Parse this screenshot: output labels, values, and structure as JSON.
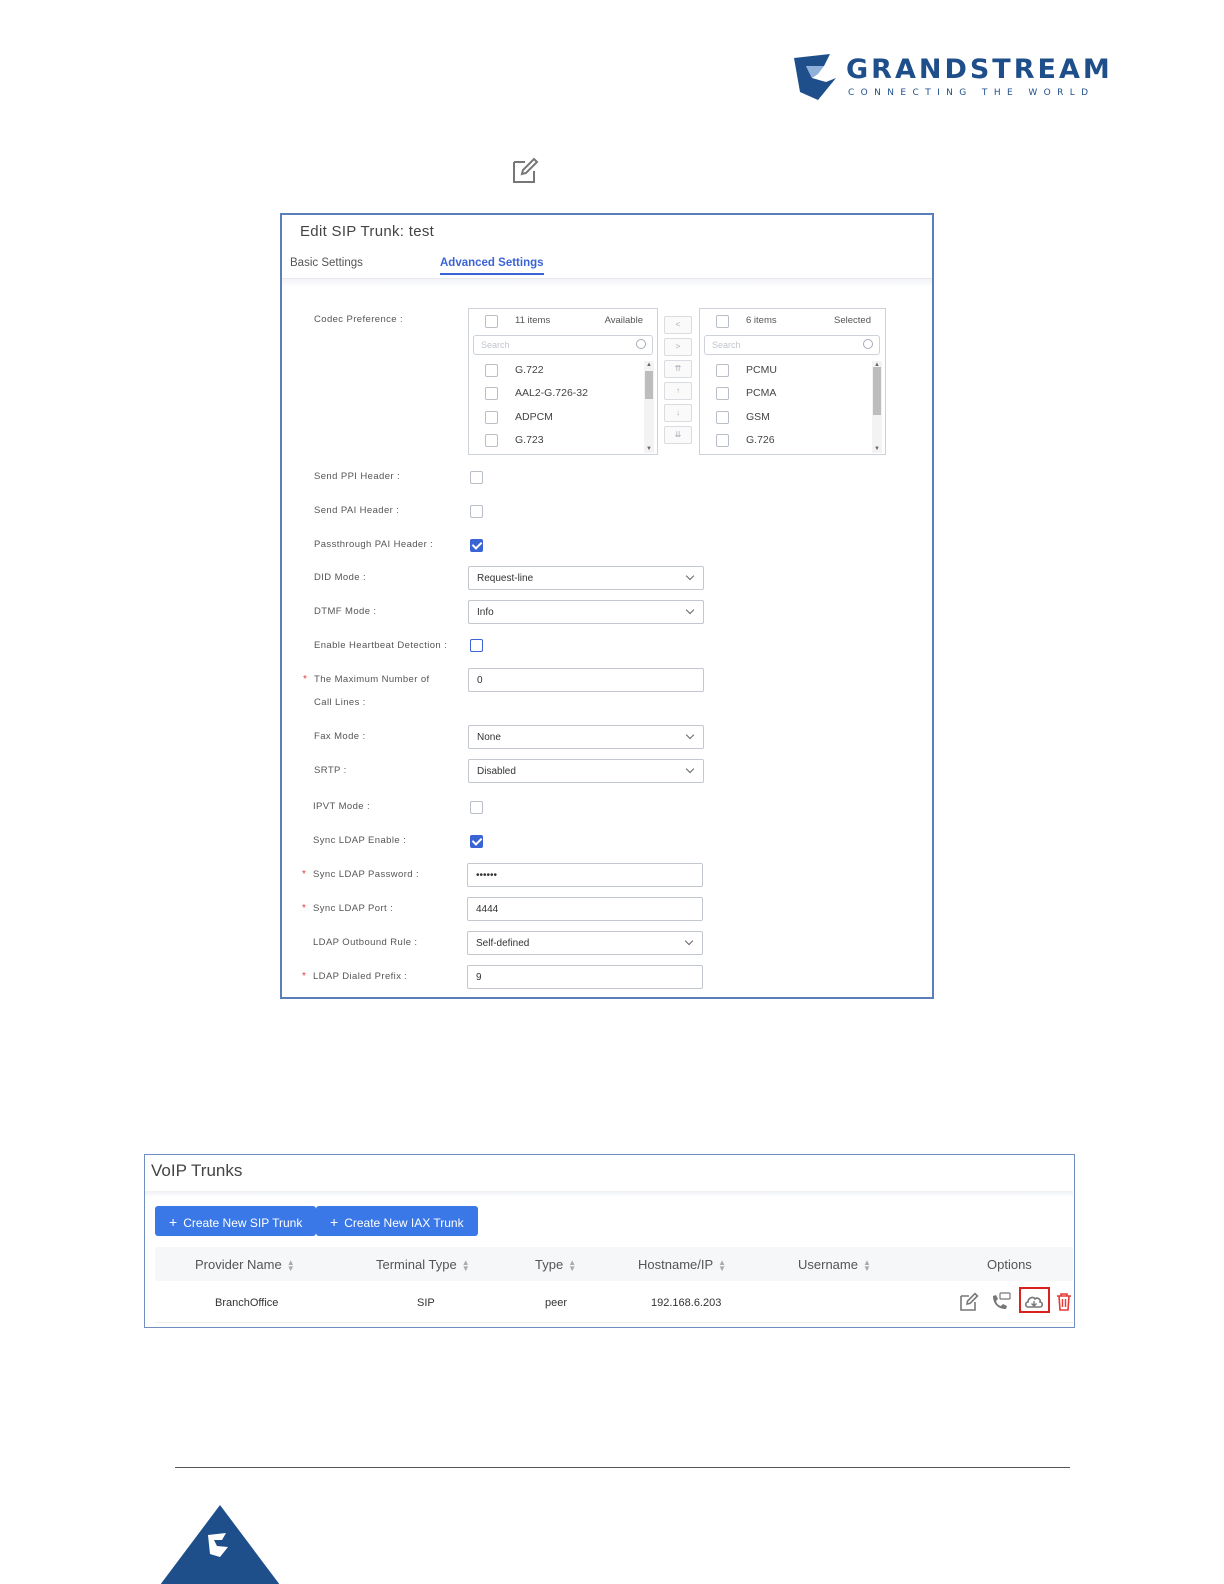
{
  "brand": {
    "name": "GRANDSTREAM",
    "tagline": "CONNECTING THE WORLD",
    "color": "#1f4f8a"
  },
  "dialog": {
    "title": "Edit SIP Trunk: test",
    "tabs": [
      "Basic Settings",
      "Advanced Settings"
    ],
    "active_tab": "Advanced Settings",
    "codec": {
      "label": "Codec Preference :",
      "available": {
        "count": "11 items",
        "title": "Available",
        "search_placeholder": "Search",
        "items": [
          "G.722",
          "AAL2-G.726-32",
          "ADPCM",
          "G.723"
        ]
      },
      "selected": {
        "count": "6 items",
        "title": "Selected",
        "search_placeholder": "Search",
        "items": [
          "PCMU",
          "PCMA",
          "GSM",
          "G.726"
        ]
      },
      "move_buttons": [
        "<",
        ">",
        "⇈",
        "↑",
        "↓",
        "⇊"
      ]
    },
    "fields": {
      "send_ppi": {
        "label": "Send PPI Header :",
        "checked": false
      },
      "send_pai": {
        "label": "Send PAI Header :",
        "checked": false
      },
      "passthrough_pai": {
        "label": "Passthrough PAI Header :",
        "checked": true
      },
      "did_mode": {
        "label": "DID Mode :",
        "value": "Request-line"
      },
      "dtmf_mode": {
        "label": "DTMF Mode :",
        "value": "Info"
      },
      "heartbeat": {
        "label": "Enable Heartbeat Detection :",
        "checked": false
      },
      "max_call_lines": {
        "label_1": "The Maximum Number of",
        "label_2": "Call Lines :",
        "value": "0"
      },
      "fax_mode": {
        "label": "Fax Mode :",
        "value": "None"
      },
      "srtp": {
        "label": "SRTP :",
        "value": "Disabled"
      },
      "ipvt_mode": {
        "label": "IPVT Mode :",
        "checked": false
      },
      "sync_ldap_enable": {
        "label": "Sync LDAP Enable :",
        "checked": true
      },
      "sync_ldap_password": {
        "label": "Sync LDAP Password :",
        "value": "••••••"
      },
      "sync_ldap_port": {
        "label": "Sync LDAP Port :",
        "value": "4444"
      },
      "ldap_outbound_rule": {
        "label": "LDAP Outbound Rule :",
        "value": "Self-defined"
      },
      "ldap_dialed_prefix": {
        "label": "LDAP Dialed Prefix :",
        "value": "9"
      }
    },
    "required_marker": "*"
  },
  "trunks": {
    "title": "VoIP Trunks",
    "buttons": {
      "create_sip": "Create New SIP Trunk",
      "create_iax": "Create New IAX Trunk"
    },
    "columns": [
      "Provider Name",
      "Terminal Type",
      "Type",
      "Hostname/IP",
      "Username",
      "Options"
    ],
    "rows": [
      {
        "provider": "BranchOffice",
        "terminal_type": "SIP",
        "type": "peer",
        "host": "192.168.6.203",
        "username": ""
      }
    ],
    "options_icons": [
      "edit-icon",
      "phone-dod-icon",
      "ldap-sync-cloud-icon",
      "delete-icon"
    ],
    "accent": "#3b78e7",
    "highlight": "#d9221c"
  }
}
